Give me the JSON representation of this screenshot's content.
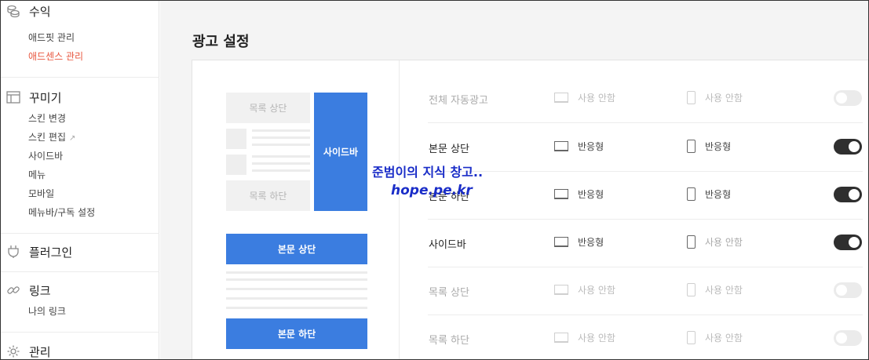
{
  "sidebar": {
    "revenue": {
      "icon": "coins-icon",
      "title": "수익",
      "items": [
        {
          "label": "애드핏 관리"
        },
        {
          "label": "애드센스 관리"
        }
      ]
    },
    "decorate": {
      "icon": "layout-icon",
      "title": "꾸미기",
      "items": [
        {
          "label": "스킨 변경"
        },
        {
          "label": "스킨 편집"
        },
        {
          "label": "사이드바"
        },
        {
          "label": "메뉴"
        },
        {
          "label": "모바일"
        },
        {
          "label": "메뉴바/구독 설정"
        }
      ]
    },
    "plugin": {
      "icon": "plug-icon",
      "title": "플러그인"
    },
    "link": {
      "icon": "link-icon",
      "title": "링크",
      "items": [
        {
          "label": "나의 링크"
        }
      ]
    },
    "manage": {
      "icon": "gear-icon",
      "title": "관리"
    }
  },
  "main": {
    "title": "광고 설정",
    "preview": {
      "list_top": "목록 상단",
      "list_bottom": "목록 하단",
      "sidebar": "사이드바",
      "body_top": "본문 상단",
      "body_bottom": "본문 하단"
    },
    "rows": [
      {
        "label": "전체 자동광고",
        "desktop": "사용 안함",
        "mobile": "사용 안함",
        "enabled": false
      },
      {
        "label": "본문 상단",
        "desktop": "반응형",
        "mobile": "반응형",
        "enabled": true
      },
      {
        "label": "본문 하단",
        "desktop": "반응형",
        "mobile": "반응형",
        "enabled": true
      },
      {
        "label": "사이드바",
        "desktop": "반응형",
        "mobile": "사용 안함",
        "enabled": true
      },
      {
        "label": "목록 상단",
        "desktop": "사용 안함",
        "mobile": "사용 안함",
        "enabled": false
      },
      {
        "label": "목록 하단",
        "desktop": "사용 안함",
        "mobile": "사용 안함",
        "enabled": false
      }
    ]
  },
  "watermark": {
    "line1": "준범이의 지식 창고..",
    "line2": "hope.pe.kr"
  },
  "colors": {
    "accent": "#3b7de0",
    "active_menu": "#e8573f",
    "toggle_on": "#2f2f2f",
    "toggle_off": "#ebebeb"
  }
}
